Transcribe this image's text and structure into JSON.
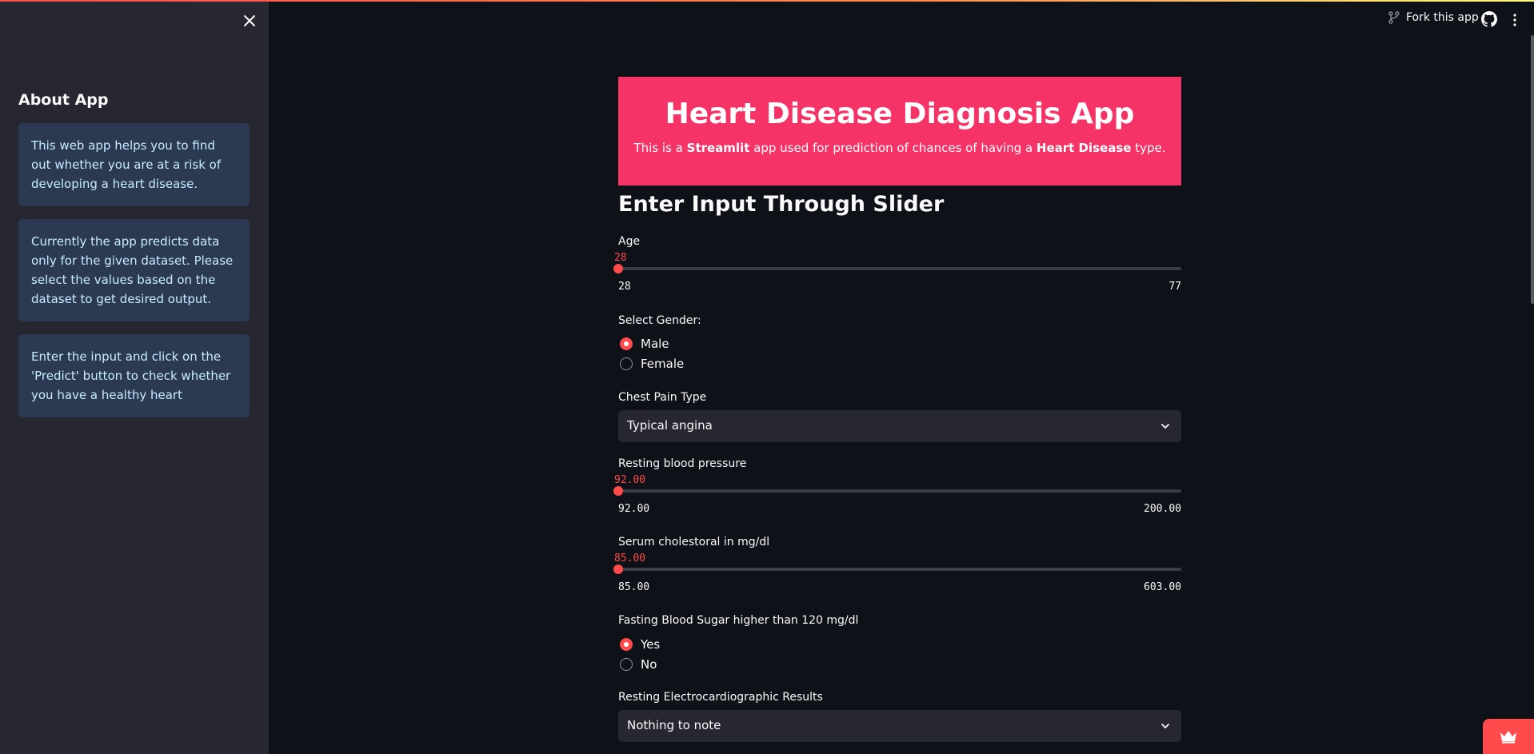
{
  "sidebar": {
    "title": "About App",
    "info": [
      "This web app helps you to find out whether you are at a risk of developing a heart disease.",
      "Currently the app predicts data only for the given dataset. Please select the values based on the dataset to get desired output.",
      "Enter the input and click on the 'Predict' button to check whether you have a healthy heart"
    ]
  },
  "header": {
    "fork_label": "Fork this app"
  },
  "banner": {
    "title": "Heart Disease Diagnosis App",
    "desc_prefix": "This is a ",
    "desc_bold1": "Streamlit",
    "desc_middle": " app used for prediction of chances of having a ",
    "desc_bold2": "Heart Disease",
    "desc_suffix": " type."
  },
  "form": {
    "section_title": "Enter Input Through Slider",
    "age": {
      "label": "Age",
      "value": "28",
      "min": "28",
      "max": "77"
    },
    "gender": {
      "label": "Select Gender:",
      "options": [
        "Male",
        "Female"
      ],
      "selected": "Male"
    },
    "chest_pain": {
      "label": "Chest Pain Type",
      "value": "Typical angina"
    },
    "rest_bp": {
      "label": "Resting blood pressure",
      "value": "92.00",
      "min": "92.00",
      "max": "200.00"
    },
    "chol": {
      "label": "Serum cholestoral in mg/dl",
      "value": "85.00",
      "min": "85.00",
      "max": "603.00"
    },
    "fbs": {
      "label": "Fasting Blood Sugar higher than 120 mg/dl",
      "options": [
        "Yes",
        "No"
      ],
      "selected": "Yes"
    },
    "ecg": {
      "label": "Resting Electrocardiographic Results",
      "value": "Nothing to note"
    }
  },
  "colors": {
    "accent": "#ff4b4b",
    "banner": "#f63366",
    "sidebar_bg": "#262730",
    "main_bg": "#0e1117",
    "info_bg": "#2b3a52"
  }
}
